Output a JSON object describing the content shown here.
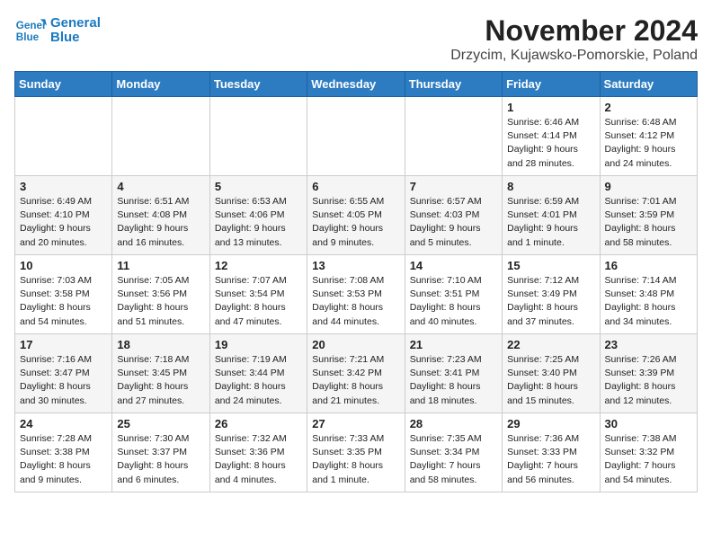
{
  "logo": {
    "line1": "General",
    "line2": "Blue"
  },
  "title": "November 2024",
  "location": "Drzycim, Kujawsko-Pomorskie, Poland",
  "weekdays": [
    "Sunday",
    "Monday",
    "Tuesday",
    "Wednesday",
    "Thursday",
    "Friday",
    "Saturday"
  ],
  "weeks": [
    [
      {
        "day": "",
        "info": ""
      },
      {
        "day": "",
        "info": ""
      },
      {
        "day": "",
        "info": ""
      },
      {
        "day": "",
        "info": ""
      },
      {
        "day": "",
        "info": ""
      },
      {
        "day": "1",
        "info": "Sunrise: 6:46 AM\nSunset: 4:14 PM\nDaylight: 9 hours\nand 28 minutes."
      },
      {
        "day": "2",
        "info": "Sunrise: 6:48 AM\nSunset: 4:12 PM\nDaylight: 9 hours\nand 24 minutes."
      }
    ],
    [
      {
        "day": "3",
        "info": "Sunrise: 6:49 AM\nSunset: 4:10 PM\nDaylight: 9 hours\nand 20 minutes."
      },
      {
        "day": "4",
        "info": "Sunrise: 6:51 AM\nSunset: 4:08 PM\nDaylight: 9 hours\nand 16 minutes."
      },
      {
        "day": "5",
        "info": "Sunrise: 6:53 AM\nSunset: 4:06 PM\nDaylight: 9 hours\nand 13 minutes."
      },
      {
        "day": "6",
        "info": "Sunrise: 6:55 AM\nSunset: 4:05 PM\nDaylight: 9 hours\nand 9 minutes."
      },
      {
        "day": "7",
        "info": "Sunrise: 6:57 AM\nSunset: 4:03 PM\nDaylight: 9 hours\nand 5 minutes."
      },
      {
        "day": "8",
        "info": "Sunrise: 6:59 AM\nSunset: 4:01 PM\nDaylight: 9 hours\nand 1 minute."
      },
      {
        "day": "9",
        "info": "Sunrise: 7:01 AM\nSunset: 3:59 PM\nDaylight: 8 hours\nand 58 minutes."
      }
    ],
    [
      {
        "day": "10",
        "info": "Sunrise: 7:03 AM\nSunset: 3:58 PM\nDaylight: 8 hours\nand 54 minutes."
      },
      {
        "day": "11",
        "info": "Sunrise: 7:05 AM\nSunset: 3:56 PM\nDaylight: 8 hours\nand 51 minutes."
      },
      {
        "day": "12",
        "info": "Sunrise: 7:07 AM\nSunset: 3:54 PM\nDaylight: 8 hours\nand 47 minutes."
      },
      {
        "day": "13",
        "info": "Sunrise: 7:08 AM\nSunset: 3:53 PM\nDaylight: 8 hours\nand 44 minutes."
      },
      {
        "day": "14",
        "info": "Sunrise: 7:10 AM\nSunset: 3:51 PM\nDaylight: 8 hours\nand 40 minutes."
      },
      {
        "day": "15",
        "info": "Sunrise: 7:12 AM\nSunset: 3:49 PM\nDaylight: 8 hours\nand 37 minutes."
      },
      {
        "day": "16",
        "info": "Sunrise: 7:14 AM\nSunset: 3:48 PM\nDaylight: 8 hours\nand 34 minutes."
      }
    ],
    [
      {
        "day": "17",
        "info": "Sunrise: 7:16 AM\nSunset: 3:47 PM\nDaylight: 8 hours\nand 30 minutes."
      },
      {
        "day": "18",
        "info": "Sunrise: 7:18 AM\nSunset: 3:45 PM\nDaylight: 8 hours\nand 27 minutes."
      },
      {
        "day": "19",
        "info": "Sunrise: 7:19 AM\nSunset: 3:44 PM\nDaylight: 8 hours\nand 24 minutes."
      },
      {
        "day": "20",
        "info": "Sunrise: 7:21 AM\nSunset: 3:42 PM\nDaylight: 8 hours\nand 21 minutes."
      },
      {
        "day": "21",
        "info": "Sunrise: 7:23 AM\nSunset: 3:41 PM\nDaylight: 8 hours\nand 18 minutes."
      },
      {
        "day": "22",
        "info": "Sunrise: 7:25 AM\nSunset: 3:40 PM\nDaylight: 8 hours\nand 15 minutes."
      },
      {
        "day": "23",
        "info": "Sunrise: 7:26 AM\nSunset: 3:39 PM\nDaylight: 8 hours\nand 12 minutes."
      }
    ],
    [
      {
        "day": "24",
        "info": "Sunrise: 7:28 AM\nSunset: 3:38 PM\nDaylight: 8 hours\nand 9 minutes."
      },
      {
        "day": "25",
        "info": "Sunrise: 7:30 AM\nSunset: 3:37 PM\nDaylight: 8 hours\nand 6 minutes."
      },
      {
        "day": "26",
        "info": "Sunrise: 7:32 AM\nSunset: 3:36 PM\nDaylight: 8 hours\nand 4 minutes."
      },
      {
        "day": "27",
        "info": "Sunrise: 7:33 AM\nSunset: 3:35 PM\nDaylight: 8 hours\nand 1 minute."
      },
      {
        "day": "28",
        "info": "Sunrise: 7:35 AM\nSunset: 3:34 PM\nDaylight: 7 hours\nand 58 minutes."
      },
      {
        "day": "29",
        "info": "Sunrise: 7:36 AM\nSunset: 3:33 PM\nDaylight: 7 hours\nand 56 minutes."
      },
      {
        "day": "30",
        "info": "Sunrise: 7:38 AM\nSunset: 3:32 PM\nDaylight: 7 hours\nand 54 minutes."
      }
    ]
  ]
}
